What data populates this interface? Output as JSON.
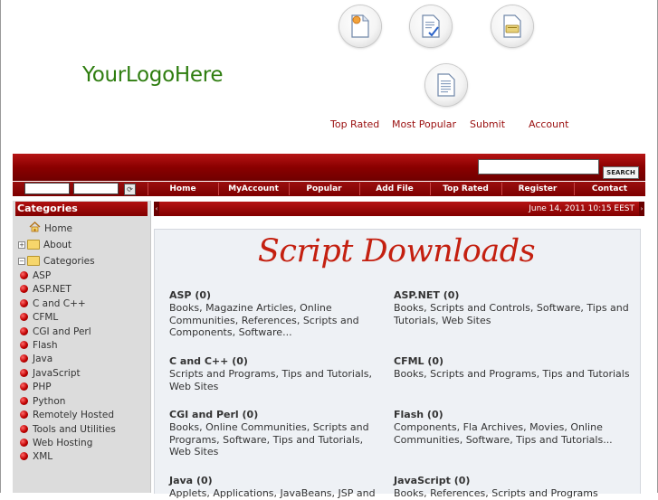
{
  "logo": {
    "text": "YourLogoHere"
  },
  "top_icons": [
    {
      "name": "new-document-icon"
    },
    {
      "name": "checked-document-icon"
    },
    {
      "name": "submit-document-icon"
    },
    {
      "name": "account-document-icon"
    }
  ],
  "top_links": [
    "Top Rated",
    "Most Popular",
    "Submit",
    "Account"
  ],
  "search": {
    "button_label": "SEARCH",
    "value": ""
  },
  "nav": [
    "Home",
    "MyAccount",
    "Popular",
    "Add File",
    "Top Rated",
    "Register",
    "Contact"
  ],
  "sidebar": {
    "title": "Categories",
    "tree": [
      "Home",
      "About",
      "Categories"
    ],
    "categories": [
      "ASP",
      "ASP.NET",
      "C and C++",
      "CFML",
      "CGI and Perl",
      "Flash",
      "Java",
      "JavaScript",
      "PHP",
      "Python",
      "Remotely Hosted",
      "Tools and Utilities",
      "Web Hosting",
      "XML"
    ]
  },
  "date": "June 14, 2011 10:15 EEST",
  "content": {
    "banner": "Script Downloads",
    "cells": [
      {
        "title": "ASP (0)",
        "desc": "Books, Magazine Articles, Online Communities, References, Scripts and Components, Software..."
      },
      {
        "title": "ASP.NET (0)",
        "desc": "Books, Scripts and Controls, Software, Tips and Tutorials, Web Sites"
      },
      {
        "title": "C and C++ (0)",
        "desc": "Scripts and Programs, Tips and Tutorials, Web Sites"
      },
      {
        "title": "CFML (0)",
        "desc": "Books, Scripts and Programs, Tips and Tutorials"
      },
      {
        "title": "CGI and Perl (0)",
        "desc": "Books, Online Communities, Scripts and Programs, Software, Tips and Tutorials, Web Sites"
      },
      {
        "title": "Flash (0)",
        "desc": "Components, Fla Archives, Movies, Online Communities, Software, Tips and Tutorials..."
      },
      {
        "title": "Java (0)",
        "desc": "Applets, Applications, JavaBeans, JSP and"
      },
      {
        "title": "JavaScript (0)",
        "desc": "Books, References, Scripts and Programs"
      }
    ]
  },
  "colors": {
    "brand_red": "#8a0000",
    "logo_green": "#2e7d0f",
    "banner_red": "#c42010",
    "link_red": "#9a0f0f"
  }
}
